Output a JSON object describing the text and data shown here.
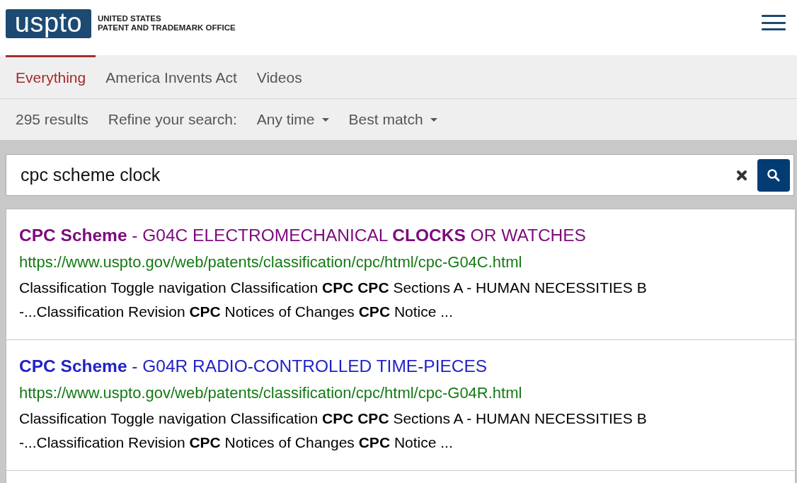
{
  "header": {
    "logo_text": "uspto",
    "agency_line_1": "UNITED STATES",
    "agency_line_2": "PATENT AND TRADEMARK OFFICE"
  },
  "tabs": [
    {
      "label": "Everything",
      "selected": true
    },
    {
      "label": "America Invents Act",
      "selected": false
    },
    {
      "label": "Videos",
      "selected": false
    }
  ],
  "filters": {
    "result_count": "295 results",
    "refine_label": "Refine your search:",
    "dropdowns": [
      {
        "label": "Any time"
      },
      {
        "label": "Best match"
      }
    ]
  },
  "search": {
    "value": "cpc scheme clock"
  },
  "results": [
    {
      "title": "**CPC Scheme** - G04C ELECTROMECHANICAL **CLOCKS** OR WATCHES",
      "visited": true,
      "url": "https://www.uspto.gov/web/patents/classification/cpc/html/cpc-G04C.html",
      "snippet": "Classification Toggle navigation Classification **CPC** **CPC** Sections A - HUMAN NECESSITIES B -...Classification Revision **CPC** Notices of Changes **CPC** Notice ..."
    },
    {
      "title": "**CPC Scheme** - G04R RADIO-CONTROLLED TIME-PIECES",
      "visited": false,
      "url": "https://www.uspto.gov/web/patents/classification/cpc/html/cpc-G04R.html",
      "snippet": "Classification Toggle navigation Classification **CPC** **CPC** Sections A - HUMAN NECESSITIES B -...Classification Revision **CPC** Notices of Changes **CPC** Notice ..."
    }
  ]
}
